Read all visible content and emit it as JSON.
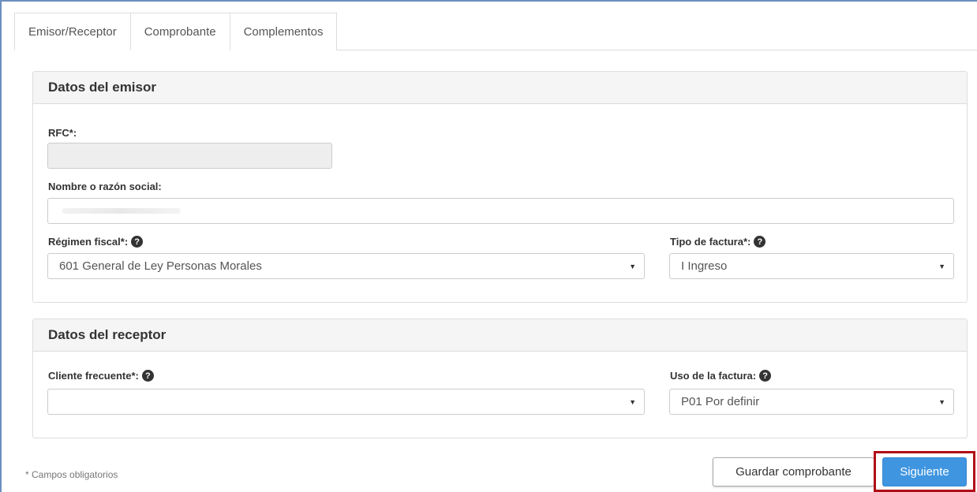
{
  "tabs": [
    {
      "label": "Emisor/Receptor",
      "active": true
    },
    {
      "label": "Comprobante",
      "active": false
    },
    {
      "label": "Complementos",
      "active": false
    }
  ],
  "emisor": {
    "title": "Datos del emisor",
    "rfc_label": "RFC*:",
    "rfc_value": "",
    "nombre_label": "Nombre o razón social:",
    "nombre_value": "",
    "regimen_label": "Régimen fiscal*:",
    "regimen_value": "601 General de Ley Personas Morales",
    "tipo_label": "Tipo de factura*:",
    "tipo_value": "I Ingreso"
  },
  "receptor": {
    "title": "Datos del receptor",
    "cliente_label": "Cliente frecuente*:",
    "cliente_value": "",
    "uso_label": "Uso de la factura:",
    "uso_value": "P01 Por definir"
  },
  "footer": {
    "note": "* Campos obligatorios",
    "save_label": "Guardar comprobante",
    "next_label": "Siguiente"
  },
  "icons": {
    "help": "question-circle-icon",
    "caret": "caret-down-icon"
  },
  "colors": {
    "primary_button": "#3f95e0",
    "highlight_border": "#b00e16",
    "panel_header_bg": "#f5f5f5"
  }
}
